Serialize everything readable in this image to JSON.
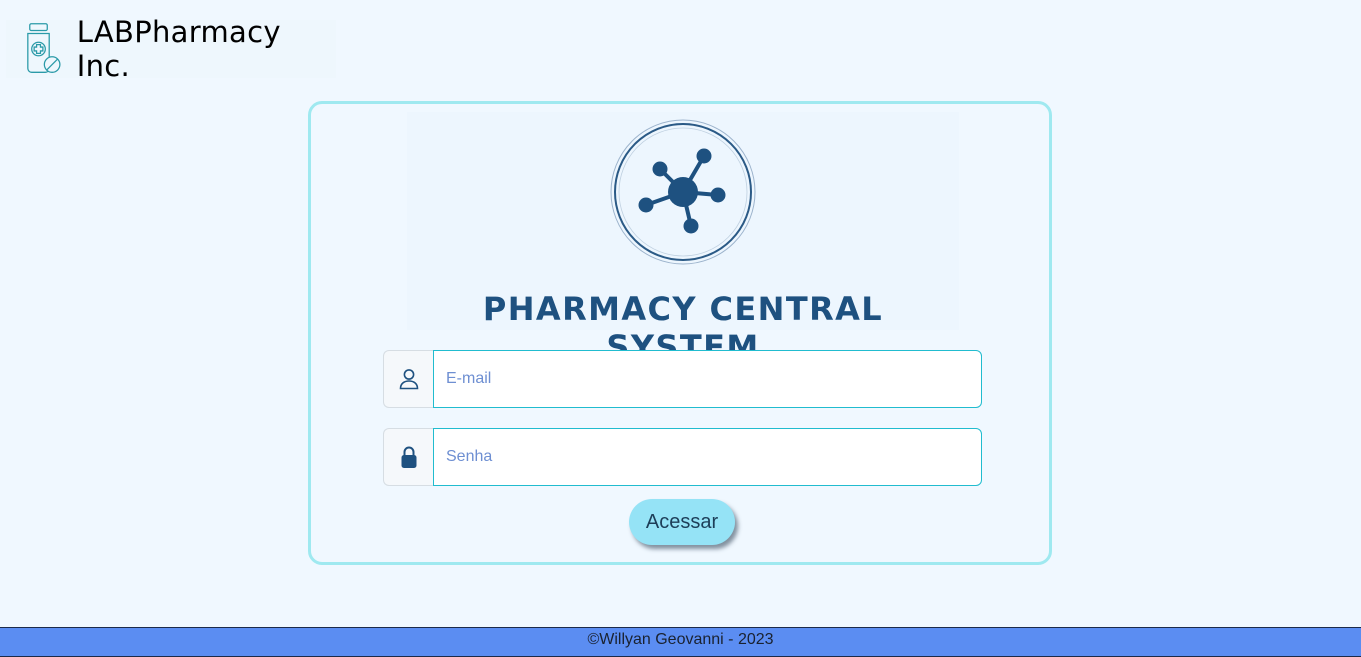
{
  "header": {
    "brand_name": "LABPharmacy Inc.",
    "logo_icon": "medicine-bottle-icon"
  },
  "hero": {
    "title": "PHARMACY CENTRAL SYSTEM",
    "emblem_icon": "molecule-icon"
  },
  "login": {
    "email_icon": "user-icon",
    "email_placeholder": "E-mail",
    "password_icon": "lock-icon",
    "password_placeholder": "Senha",
    "submit_label": "Acessar"
  },
  "footer": {
    "text": "©Willyan Geovanni - 2023"
  },
  "colors": {
    "background": "#f0f8ff",
    "card_border": "#9fe9f0",
    "input_border": "#21bccf",
    "button": "#95e3f6",
    "footer": "#5b8df2",
    "hero_title": "#1e5180"
  }
}
